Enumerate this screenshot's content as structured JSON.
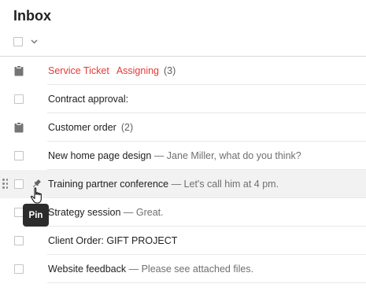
{
  "header": {
    "title": "Inbox"
  },
  "rows": [
    {
      "icon": "clipboard-icon",
      "subject": "Service Ticket",
      "subject_red": true,
      "tag": "Assigning",
      "count": "(3)",
      "snippet": ""
    },
    {
      "icon": "checkbox",
      "subject": "Contract approval:",
      "subject_red": false,
      "tag": "",
      "count": "",
      "snippet": ""
    },
    {
      "icon": "clipboard-icon",
      "subject": "Customer order",
      "subject_red": false,
      "tag": "",
      "count": "(2)",
      "snippet": ""
    },
    {
      "icon": "checkbox",
      "subject": "New home page design",
      "subject_red": false,
      "tag": "",
      "count": "",
      "snippet": " — Jane Miller, what do you think?"
    },
    {
      "icon": "pin-icon",
      "subject": "Training partner conference",
      "subject_red": false,
      "tag": "",
      "count": "",
      "snippet": " — Let's call him at 4 pm.",
      "hover": true
    },
    {
      "icon": "checkbox",
      "subject": "Strategy session",
      "subject_red": false,
      "tag": "",
      "count": "",
      "snippet": " — Great."
    },
    {
      "icon": "checkbox",
      "subject": "Client Order: GIFT PROJECT",
      "subject_red": false,
      "tag": "",
      "count": "",
      "snippet": ""
    },
    {
      "icon": "checkbox",
      "subject": "Website feedback",
      "subject_red": false,
      "tag": "",
      "count": "",
      "snippet": " — Please see attached files."
    }
  ],
  "tooltip": {
    "text": "Pin"
  },
  "colors": {
    "accent_red": "#e53935",
    "hover_row": "#f2f2f2"
  }
}
